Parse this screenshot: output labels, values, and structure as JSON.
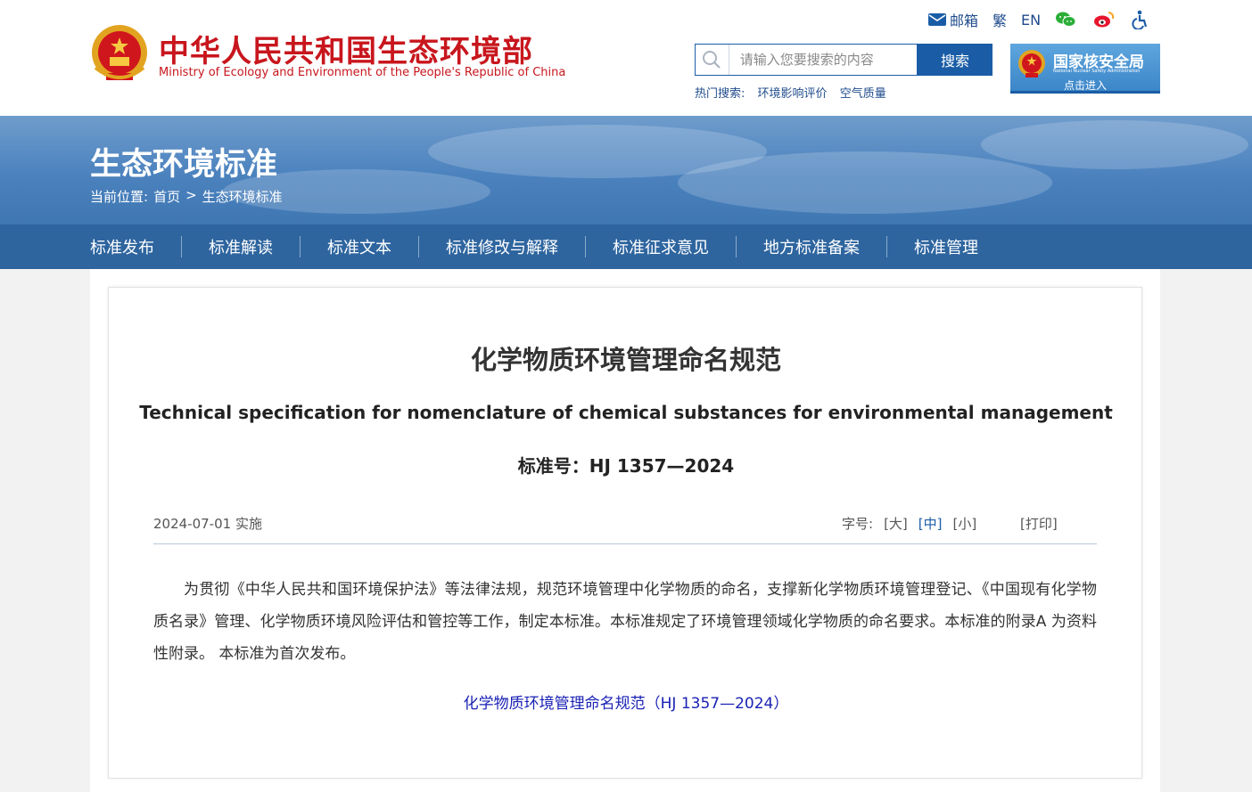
{
  "header": {
    "site_title": "中华人民共和国生态环境部",
    "site_subtitle": "Ministry of Ecology and Environment of the People's Republic of China",
    "top_links": {
      "mail": "邮箱",
      "traditional": "繁",
      "english": "EN"
    },
    "search": {
      "placeholder": "请输入您要搜索的内容",
      "button": "搜索"
    },
    "hot_search": {
      "label": "热门搜索:",
      "items": [
        "环境影响评价",
        "空气质量"
      ]
    },
    "nnsa": {
      "name": "国家核安全局",
      "name_en": "National Nuclear Safety Administration",
      "enter": "点击进入"
    }
  },
  "banner": {
    "title": "生态环境标准",
    "breadcrumb": {
      "label": "当前位置:",
      "home": "首页",
      "separator": ">",
      "current": "生态环境标准"
    }
  },
  "nav": {
    "items": [
      "标准发布",
      "标准解读",
      "标准文本",
      "标准修改与解释",
      "标准征求意见",
      "地方标准备案",
      "标准管理"
    ]
  },
  "article": {
    "title_cn": "化学物质环境管理命名规范",
    "title_en": "Technical specification for nomenclature of chemical substances for environmental management",
    "standard_no": "标准号：HJ 1357—2024",
    "effective": "2024-07-01 实施",
    "font_size": {
      "label": "字号:",
      "large": "[大]",
      "medium": "[中]",
      "small": "[小]"
    },
    "print": "[打印]",
    "body": "为贯彻《中华人民共和国环境保护法》等法律法规，规范环境管理中化学物质的命名，支撑新化学物质环境管理登记、《中国现有化学物质名录》管理、化学物质环境风险评估和管控等工作，制定本标准。本标准规定了环境管理领域化学物质的命名要求。本标准的附录A 为资料性附录。 本标准为首次发布。",
    "attachment": "化学物质环境管理命名规范（HJ 1357—2024）"
  },
  "colors": {
    "brand_red": "#c8161d",
    "nav_blue": "#2e659f",
    "link_blue": "#1a5da6",
    "attachment_blue": "#1a22b5"
  }
}
